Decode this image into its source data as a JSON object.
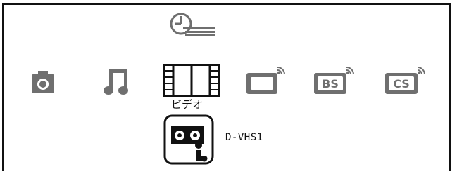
{
  "menu": {
    "top_icon": "timer-list-icon",
    "categories": [
      {
        "id": "photo",
        "icon": "camera-icon",
        "selected": false
      },
      {
        "id": "music",
        "icon": "music-note-icon",
        "selected": false
      },
      {
        "id": "video",
        "icon": "film-strip-icon",
        "label": "ビデオ",
        "selected": true
      },
      {
        "id": "terrestrial",
        "icon": "tv-icon",
        "selected": false
      },
      {
        "id": "bs",
        "icon": "bs-tv-icon",
        "badge": "BS",
        "selected": false
      },
      {
        "id": "cs",
        "icon": "cs-tv-icon",
        "badge": "CS",
        "selected": false
      }
    ],
    "devices": [
      {
        "icon": "vhs-deck-icon",
        "label": "D-VHS1",
        "selected": true
      }
    ]
  },
  "colors": {
    "icon_gray": "#6f6f6f",
    "icon_black": "#111111",
    "frame": "#111111"
  }
}
